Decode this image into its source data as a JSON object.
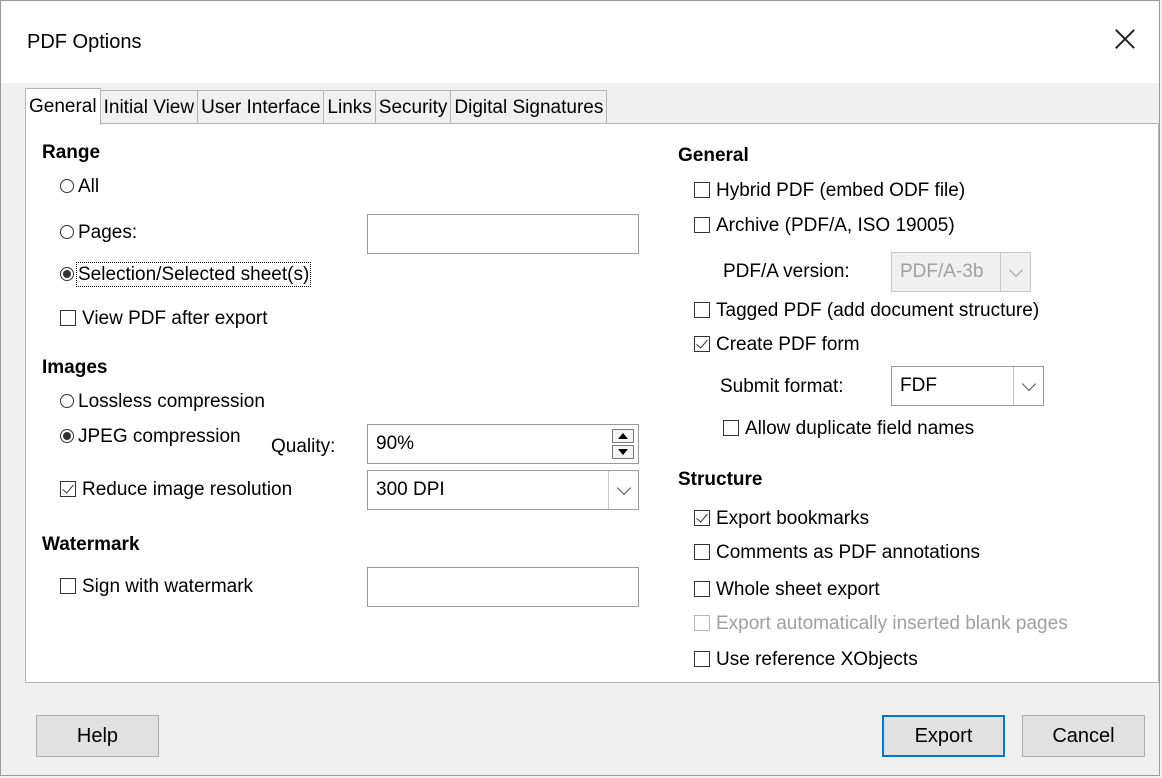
{
  "window": {
    "title": "PDF Options"
  },
  "tabs": [
    {
      "label": "General",
      "active": true
    },
    {
      "label": "Initial View"
    },
    {
      "label": "User Interface"
    },
    {
      "label": "Links"
    },
    {
      "label": "Security"
    },
    {
      "label": "Digital Signatures"
    }
  ],
  "range": {
    "heading": "Range",
    "all_label": "All",
    "pages_label": "Pages:",
    "pages_value": "",
    "selection_label": "Selection/Selected sheet(s)",
    "view_pdf_label": "View PDF after export"
  },
  "images": {
    "heading": "Images",
    "lossless_label": "Lossless compression",
    "jpeg_label": "JPEG compression",
    "quality_label": "Quality:",
    "quality_value": "90%",
    "reduce_label": "Reduce image resolution",
    "resolution_value": "300 DPI"
  },
  "watermark": {
    "heading": "Watermark",
    "sign_label": "Sign with watermark",
    "text_value": ""
  },
  "general": {
    "heading": "General",
    "hybrid_label": "Hybrid PDF (embed ODF file)",
    "archive_label": "Archive (PDF/A, ISO 19005)",
    "pdfa_version_label": "PDF/A version:",
    "pdfa_version_value": "PDF/A-3b",
    "tagged_label": "Tagged PDF (add document structure)",
    "create_form_label": "Create PDF form",
    "submit_format_label": "Submit format:",
    "submit_format_value": "FDF",
    "allow_dup_label": "Allow duplicate field names"
  },
  "structure": {
    "heading": "Structure",
    "export_bookmarks_label": "Export bookmarks",
    "comments_label": "Comments as PDF annotations",
    "whole_sheet_label": "Whole sheet export",
    "blank_pages_label": "Export automatically inserted blank pages",
    "xobjects_label": "Use reference XObjects"
  },
  "buttons": {
    "help": "Help",
    "export": "Export",
    "cancel": "Cancel"
  },
  "colors": {
    "accent": "#0078d7",
    "disabled_text": "#a0a0a0"
  }
}
